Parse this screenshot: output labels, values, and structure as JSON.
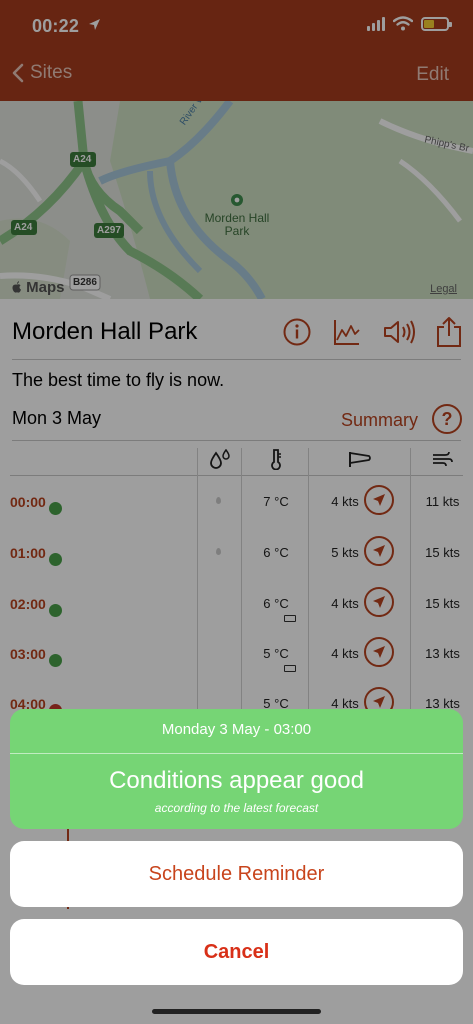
{
  "status_bar": {
    "time": "00:22"
  },
  "nav": {
    "back_label": "Sites",
    "edit_label": "Edit"
  },
  "map": {
    "labels": {
      "river": "River Wandle",
      "place": "Morden Hall Park",
      "road_a24_top": "A24",
      "road_a24_left": "A24",
      "road_a297": "A297",
      "road_b286": "B286",
      "street": "Phipp's Br"
    },
    "brand": "Maps",
    "legal": "Legal"
  },
  "site": {
    "name": "Morden Hall Park",
    "best_time": "The best time to fly is now."
  },
  "day": {
    "label": "Mon 3 May",
    "summary_label": "Summary",
    "help": "?"
  },
  "forecast": {
    "rows": [
      {
        "time": "00:00",
        "status": "ok",
        "rain": true,
        "temp": "7 °C",
        "battery": false,
        "wind": "4 kts",
        "gust": "11 kts"
      },
      {
        "time": "01:00",
        "status": "ok",
        "rain": true,
        "temp": "6 °C",
        "battery": false,
        "wind": "5 kts",
        "gust": "15 kts"
      },
      {
        "time": "02:00",
        "status": "ok",
        "rain": false,
        "temp": "6 °C",
        "battery": true,
        "wind": "4 kts",
        "gust": "15 kts"
      },
      {
        "time": "03:00",
        "status": "ok",
        "rain": false,
        "temp": "5 °C",
        "battery": true,
        "wind": "4 kts",
        "gust": "13 kts"
      },
      {
        "time": "04:00",
        "status": "warn",
        "rain": false,
        "temp": "5 °C",
        "battery": true,
        "wind": "4 kts",
        "gust": "13 kts"
      }
    ]
  },
  "sheet": {
    "date": "Monday 3 May - 03:00",
    "headline": "Conditions appear good",
    "subtext": "according to the latest forecast",
    "schedule_label": "Schedule Reminder",
    "cancel_label": "Cancel"
  },
  "colors": {
    "nav": "#a63c1e",
    "accent": "#b8431f",
    "good": "#76d575",
    "ok": "#4aa14a",
    "warn": "#c0392b"
  }
}
